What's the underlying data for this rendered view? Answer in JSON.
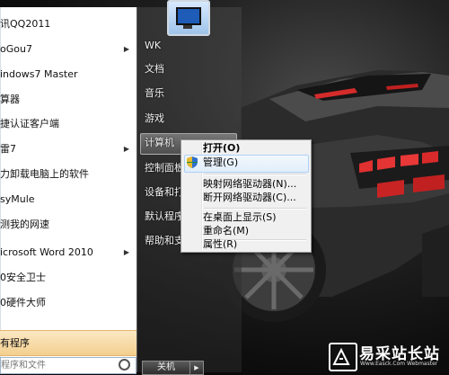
{
  "start_menu": {
    "programs": [
      {
        "label": "讯QQ2011",
        "has_submenu": false
      },
      {
        "label": "oGou7",
        "has_submenu": true
      },
      {
        "label": "indows7 Master",
        "has_submenu": false
      },
      {
        "label": "算器",
        "has_submenu": false
      },
      {
        "label": "捷认证客户端",
        "has_submenu": false
      },
      {
        "label": "雷7",
        "has_submenu": true
      },
      {
        "label": "力卸载电脑上的软件",
        "has_submenu": false
      },
      {
        "label": "syMule",
        "has_submenu": false
      },
      {
        "label": "测我的网速",
        "has_submenu": false
      },
      {
        "label": "icrosoft Word 2010",
        "has_submenu": true
      },
      {
        "label": "0安全卫士",
        "has_submenu": false
      },
      {
        "label": "0硬件大师",
        "has_submenu": false
      }
    ],
    "all_programs_label": "有程序",
    "search_placeholder": "程序和文件",
    "right_items": [
      "WK",
      "文档",
      "音乐",
      "游戏",
      "计算机",
      "控制面板",
      "设备和打印",
      "默认程序",
      "帮助和支持"
    ],
    "shutdown_label": "关机"
  },
  "context_menu": {
    "items": [
      "打开(O)",
      "管理(G)",
      "映射网络驱动器(N)...",
      "断开网络驱动器(C)...",
      "在桌面上显示(S)",
      "重命名(M)",
      "属性(R)"
    ],
    "highlighted": "管理(G)"
  },
  "watermark": {
    "title": "易采站长站",
    "url": "Www.Easck.Com  Webmaster"
  },
  "icons": [
    "monitor-icon",
    "shield-icon",
    "chevron-right-icon",
    "search-icon",
    "logo-icon"
  ]
}
